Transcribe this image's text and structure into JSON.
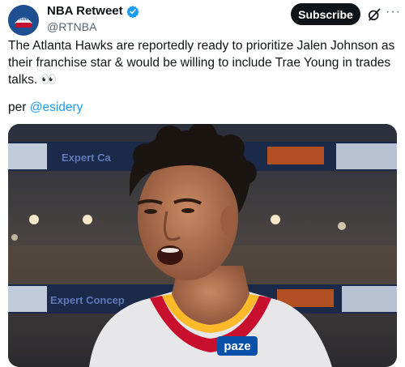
{
  "account": {
    "name": "NBA Retweet",
    "handle": "@RTNBA",
    "avatar_text": "Retweet",
    "verified_icon": "verified-badge-icon"
  },
  "actions": {
    "subscribe_label": "Subscribe",
    "grok_icon": "grok-icon",
    "more_label": "···"
  },
  "post": {
    "text": "The Atlanta Hawks are reportedly ready to prioritize Jalen Johnson as their franchise star & would be willing to include Trae Young in trades talks. 👀",
    "per_prefix": "per ",
    "mention": "@esidery"
  },
  "media": {
    "banner_top": "Expert Ca",
    "banner_bottom": "Expert Concep",
    "jersey_logo": "paze"
  },
  "colors": {
    "accent": "#1d9bf0",
    "subscribe_bg": "#0f1419",
    "jersey_red": "#c8102e",
    "jersey_yellow": "#fdb927"
  }
}
